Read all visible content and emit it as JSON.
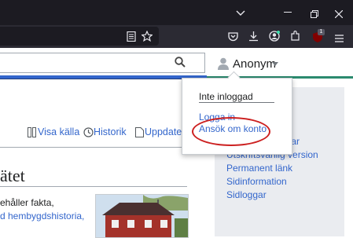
{
  "user": {
    "name": "Anonym"
  },
  "tabs": [
    {
      "label": "Visa källa"
    },
    {
      "label": "Historik"
    },
    {
      "label": "Uppdater"
    }
  ],
  "article": {
    "title": "ätet",
    "line1": "ehåller fakta,",
    "line2": "d hembygdshistoria,"
  },
  "dropdown": {
    "title": "Inte inloggad",
    "login": "Logga in",
    "create": "Ansök om konto"
  },
  "sidebar": {
    "items": [
      "t",
      "ggar",
      "Utskriftsvänlig version",
      "Permanent länk",
      "Sidinformation",
      "Sidloggar"
    ]
  },
  "extensions": {
    "badge": "1"
  },
  "colors": {
    "link": "#3366cc",
    "accent_blue": "#3366cc",
    "accent_green": "#2b8a6e",
    "annotation": "#cc2020"
  }
}
